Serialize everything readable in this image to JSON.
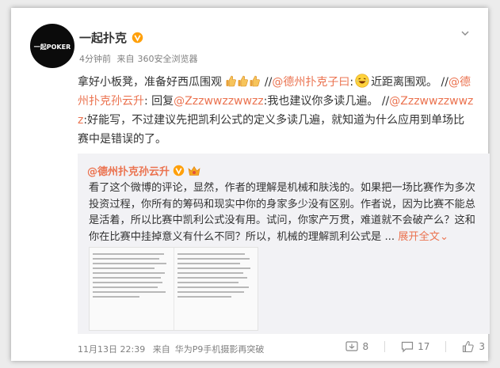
{
  "author": {
    "name": "一起扑克",
    "verified_color": "#ffa00a",
    "avatar_logo": "一起POKER"
  },
  "meta": {
    "time": "4分钟前",
    "source_prefix": "来自",
    "source": "360安全浏览器"
  },
  "post": {
    "t1": "拿好小板凳，准备好西瓜围观",
    "sep1": " //",
    "at1": "@德州扑克子曰",
    "colon1": ":",
    "t2": "近距离围观。",
    "sep2": " //",
    "at2": "@德州扑克孙云升",
    "t3": ": 回复",
    "at3": "@Zzzwwzzwwzz",
    "t4": ":我也建议你多读几遍。",
    "sep3": " //",
    "at4": "@Zzzwwzzwwzz",
    "t5": ":好能写，不过建议先把凯利公式的定义多读几遍，就知道为什么应用到单场比赛中是错误的了。",
    "emoji_thumb": "thumbs-up-icon",
    "emoji_laugh": "laughing-icon"
  },
  "repost": {
    "author": "@德州扑克孙云升",
    "text": "看了这个微博的评论，显然，作者的理解是机械和肤浅的。如果把一场比赛作为多次投资过程，你所有的筹码和现实中你的身家多少没有区别。作者说，因为比赛不能总是活着，所以比赛中凯利公式没有用。试问，你家产万贯，难道就不会破产么？这和你在比赛中挂掉意义有什么不同？所以，机械的理解凯利公式是 ... ",
    "expand": "展开全文",
    "expand_arrow": "⌄"
  },
  "footer": {
    "date": "11月13日 22:39",
    "source_prefix": "来自",
    "source": "华为P9手机摄影再突破",
    "repost_count": "8",
    "comment_count": "17",
    "like_count": "3"
  },
  "colors": {
    "accent": "#eb7350",
    "text": "#333333",
    "muted": "#808080",
    "repost_bg": "#f2f2f5"
  }
}
